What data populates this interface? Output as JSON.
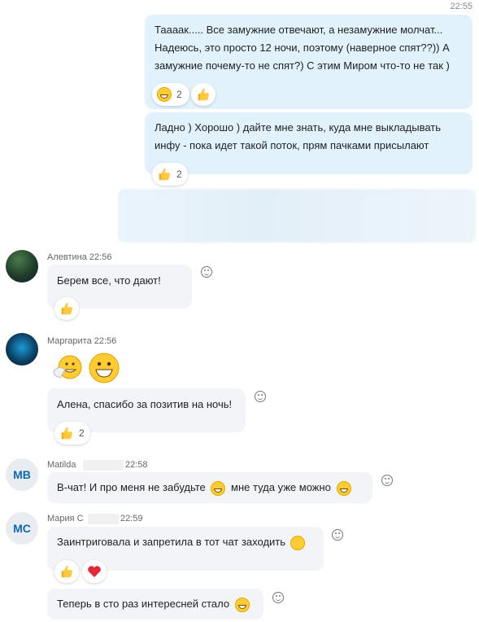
{
  "chat": {
    "top_time": "22:55",
    "outgoing": [
      {
        "text": "Тааaак..... Все замужние отвечают, а незамужние молчат... Надеюсь, это просто 12 ночи, поэтому (наверное спят??)) А замужние почему-то не спят?) С этим Миром что-то не так )",
        "reactions": [
          {
            "icon": "grin-icon",
            "count": "2"
          },
          {
            "icon": "thumbs-up-icon",
            "count": ""
          }
        ]
      },
      {
        "text": "Ладно ) Хорошо ) дайте мне знать, куда мне выкладывать инфу - пока идет такой поток, прям пачками присылают",
        "reactions": [
          {
            "icon": "thumbs-up-icon",
            "count": "2"
          }
        ]
      }
    ],
    "alevtina": {
      "header": "Алевтина 22:56",
      "message": "Берем все, что дают!",
      "reaction_icon": "thumbs-up-icon"
    },
    "margarita": {
      "header": "Маргарита 22:56",
      "stickers": [
        "laughing-face-icon",
        "grinning-face-icon"
      ],
      "message": "Алена, спасибо за позитив на ночь!",
      "reaction_count": "2"
    },
    "matilda": {
      "initials": "MB",
      "name": "Matilda",
      "time": "22:58",
      "message_part1": "В-чат! И про меня не забудьте",
      "message_part2": "мне туда уже можно"
    },
    "maria": {
      "initials": "MC",
      "name": "Мария С",
      "time": "22:59",
      "message1": "Заинтриговала и запретила в тот чат заходить",
      "message2": "Теперь в сто раз интересней стало"
    }
  },
  "colors": {
    "outgoing_bubble": "#e1f2fc",
    "incoming_bubble": "#f2f4f7",
    "initials_text": "#0a6ab8",
    "heart": "#e02a3a"
  }
}
